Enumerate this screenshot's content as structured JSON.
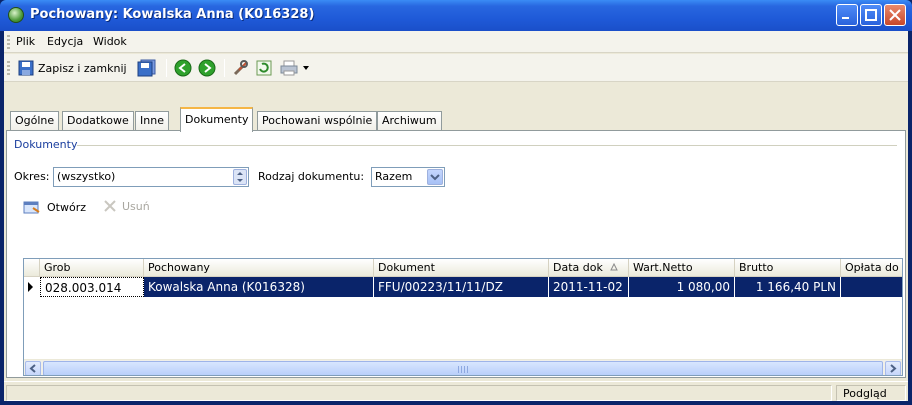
{
  "window": {
    "title": "Pochowany: Kowalska Anna (K016328)"
  },
  "menu": {
    "items": [
      {
        "label": "Plik"
      },
      {
        "label": "Edycja"
      },
      {
        "label": "Widok"
      }
    ]
  },
  "toolbar": {
    "save_close_label": "Zapisz i zamknij",
    "icons": [
      "save-icon",
      "save-all-icon",
      "back-icon",
      "forward-icon",
      "tools-icon",
      "refresh-icon",
      "print-icon",
      "dropdown-arrow-icon"
    ]
  },
  "tabs": [
    {
      "label": "Ogólne"
    },
    {
      "label": "Dodatkowe"
    },
    {
      "label": "Inne"
    },
    {
      "label": "Dokumenty"
    },
    {
      "label": "Pochowani wspólnie"
    },
    {
      "label": "Archiwum"
    }
  ],
  "documents": {
    "group_title": "Dokumenty",
    "period_label": "Okres:",
    "period_value": "(wszystko)",
    "doc_type_label": "Rodzaj dokumentu:",
    "doc_type_value": "Razem",
    "open_label": "Otwórz",
    "delete_label": "Usuń",
    "columns": [
      "Grob",
      "Pochowany",
      "Dokument",
      "Data dok",
      "Wart.Netto",
      "Brutto",
      "Opłata do"
    ],
    "rows": [
      {
        "grob": "028.003.014",
        "pochowany": "Kowalska Anna (K016328)",
        "dokument": "FFU/00223/11/11/DZ",
        "data": "2011-11-02",
        "netto": "1 080,00",
        "brutto": "1 166,40 PLN",
        "oplata": ""
      }
    ]
  },
  "status": {
    "right_label": "Podgląd"
  },
  "colors": {
    "title_bar": "#2867e0",
    "selection": "#0a246a",
    "active_tab_accent": "#f5b646"
  }
}
